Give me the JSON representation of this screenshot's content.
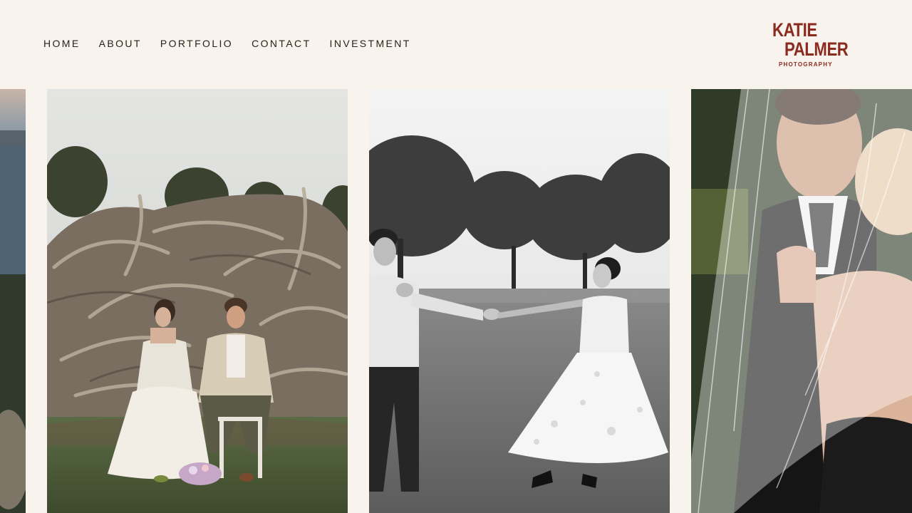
{
  "nav": {
    "items": [
      {
        "label": "HOME"
      },
      {
        "label": "ABOUT"
      },
      {
        "label": "PORTFOLIO"
      },
      {
        "label": "CONTACT"
      },
      {
        "label": "INVESTMENT"
      }
    ]
  },
  "logo": {
    "line1": "KATIE",
    "line2": "PALMER",
    "line3": "PHOTOGRAPHY"
  },
  "colors": {
    "background": "#f8f3ec",
    "brand": "#8b2a1f",
    "nav_text": "#2a211c"
  },
  "gallery": {
    "photos": [
      {
        "subject": "coastal landscape at dusk (partially visible)"
      },
      {
        "subject": "couple seated in front of driftwood pile"
      },
      {
        "subject": "black and white couple holding hands in field"
      },
      {
        "subject": "couple embracing under bridal veil (partially visible)"
      }
    ]
  }
}
